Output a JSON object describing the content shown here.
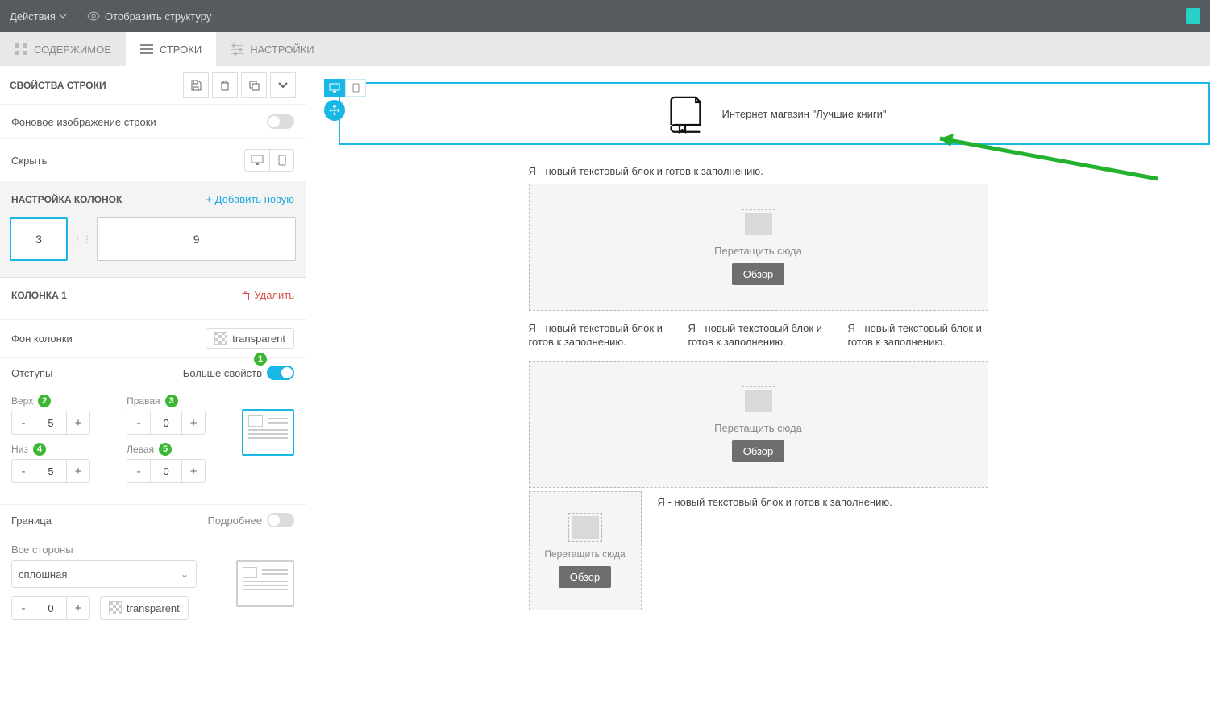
{
  "topbar": {
    "actions": "Действия",
    "show_structure": "Отобразить структуру"
  },
  "tabs": {
    "content": "СОДЕРЖИМОЕ",
    "rows": "СТРОКИ",
    "settings": "НАСТРОЙКИ"
  },
  "row_props": {
    "title": "СВОЙСТВА СТРОКИ",
    "bg_image": "Фоновое изображение строки",
    "hide": "Скрыть"
  },
  "cols": {
    "title": "НАСТРОЙКА КОЛОНОК",
    "add": "+  Добавить новую",
    "col_a": "3",
    "col_b": "9"
  },
  "column1": {
    "title": "КОЛОНКА 1",
    "delete": "Удалить",
    "bg": "Фон колонки",
    "bg_value": "transparent",
    "padding_label": "Отступы",
    "more_props": "Больше свойств",
    "top": "Верх",
    "right": "Правая",
    "bottom": "Низ",
    "left": "Левая",
    "top_v": "5",
    "right_v": "0",
    "bottom_v": "5",
    "left_v": "0",
    "b1": "1",
    "b2": "2",
    "b3": "3",
    "b4": "4",
    "b5": "5"
  },
  "border": {
    "title": "Граница",
    "more": "Подробнее",
    "all_sides": "Все стороны",
    "style": "сплошная",
    "width": "0",
    "color": "transparent"
  },
  "canvas": {
    "store_name": "Интернет магазин \"Лучшие книги\"",
    "textblock": "Я - новый текстовый блок и готов к заполнению.",
    "drag_here": "Перетащить сюда",
    "browse": "Обзор"
  }
}
